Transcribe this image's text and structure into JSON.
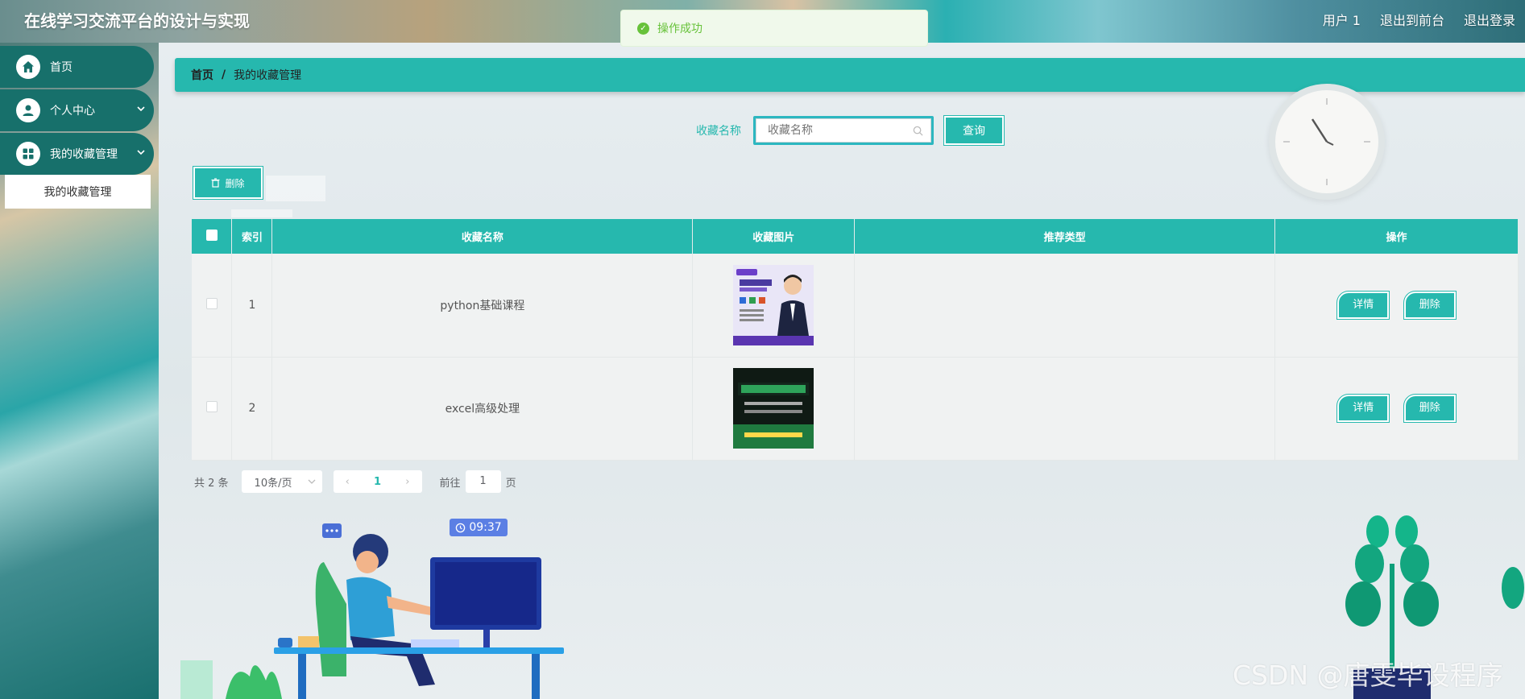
{
  "header": {
    "app_title": "在线学习交流平台的设计与实现",
    "user": "用户 1",
    "back_to_front": "退出到前台",
    "logout": "退出登录"
  },
  "toast": {
    "message": "操作成功",
    "color": "#67c23a"
  },
  "sidebar": {
    "items": [
      {
        "label": "首页",
        "icon": "home-icon"
      },
      {
        "label": "个人中心",
        "icon": "user-icon"
      },
      {
        "label": "我的收藏管理",
        "icon": "grid-icon"
      }
    ],
    "submenu": {
      "label": "我的收藏管理"
    }
  },
  "breadcrumb": {
    "home": "首页",
    "separator": "/",
    "current": "我的收藏管理"
  },
  "search": {
    "label": "收藏名称",
    "placeholder": "收藏名称",
    "button": "查询"
  },
  "toolbar": {
    "delete_label": "删除"
  },
  "table": {
    "headers": [
      "索引",
      "收藏名称",
      "收藏图片",
      "推荐类型",
      "操作"
    ],
    "rows": [
      {
        "index": "1",
        "name": "python基础课程",
        "image": "python-course-cover",
        "type": "",
        "detail": "详情",
        "delete": "删除"
      },
      {
        "index": "2",
        "name": "excel高级处理",
        "image": "excel-course-cover",
        "type": "",
        "detail": "详情",
        "delete": "删除"
      }
    ]
  },
  "pagination": {
    "total": "共 2 条",
    "page_size": "10条/页",
    "current_page": "1",
    "goto_label": "前往",
    "goto_value": "1",
    "page_suffix": "页"
  },
  "illustration": {
    "time": "09:37"
  },
  "watermark": "CSDN @唐雯毕设程序",
  "colors": {
    "accent": "#26b8ae",
    "sidebar_item": "#17706b",
    "success": "#67c23a"
  }
}
